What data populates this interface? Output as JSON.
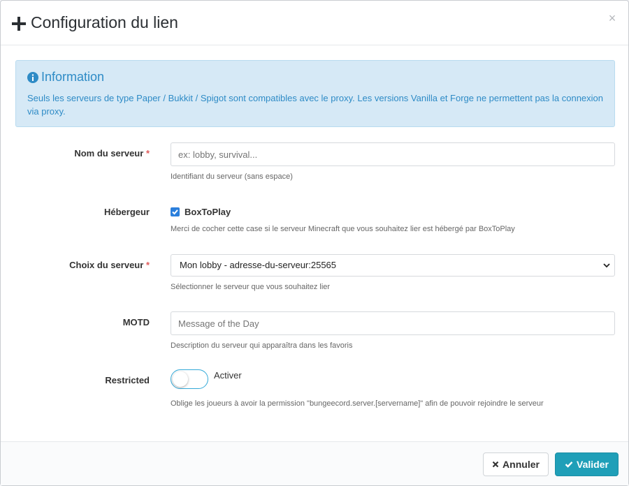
{
  "modal": {
    "title": "Configuration du lien",
    "close": "×"
  },
  "alert": {
    "heading": "Information",
    "text": "Seuls les serveurs de type Paper / Bukkit / Spigot sont compatibles avec le proxy. Les versions Vanilla et Forge ne permettent pas la connexion via proxy."
  },
  "form": {
    "server_name": {
      "label": "Nom du serveur",
      "required_mark": "*",
      "placeholder": "ex: lobby, survival...",
      "help": "Identifiant du serveur (sans espace)"
    },
    "host": {
      "label": "Hébergeur",
      "checkbox_label": "BoxToPlay",
      "checked": true,
      "help": "Merci de cocher cette case si le serveur Minecraft que vous souhaitez lier est hébergé par BoxToPlay"
    },
    "server_choice": {
      "label": "Choix du serveur",
      "required_mark": "*",
      "selected": "Mon lobby - adresse-du-serveur:25565",
      "help": "Sélectionner le serveur que vous souhaitez lier"
    },
    "motd": {
      "label": "MOTD",
      "placeholder": "Message of the Day",
      "help": "Description du serveur qui apparaîtra dans les favoris"
    },
    "restricted": {
      "label": "Restricted",
      "toggle_label": "Activer",
      "enabled": false,
      "help": "Oblige les joueurs à avoir la permission \"bungeecord.server.[servername]\" afin de pouvoir rejoindre le serveur"
    }
  },
  "footer": {
    "cancel_label": "Annuler",
    "submit_label": "Valider"
  },
  "colors": {
    "info_text": "#2e8bc6",
    "alert_bg": "#d6e9f6",
    "submit_bg": "#1f9fb8",
    "required": "#e05b5b",
    "checkbox": "#2b7fdc",
    "toggle_border": "#33a9d8"
  }
}
